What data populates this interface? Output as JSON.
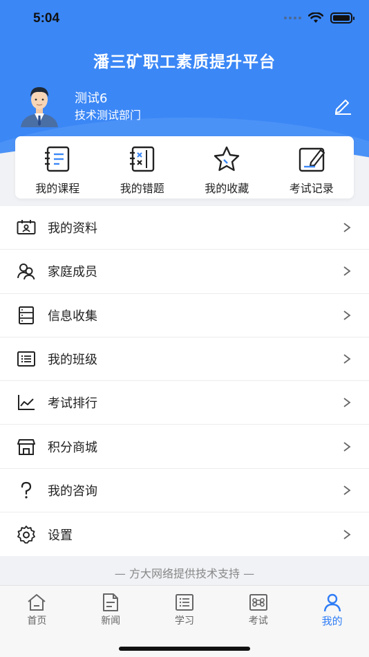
{
  "status_bar": {
    "time": "5:04"
  },
  "header": {
    "title": "潘三矿职工素质提升平台"
  },
  "user": {
    "name": "测试6",
    "department": "技术测试部门"
  },
  "shortcuts": [
    {
      "label": "我的课程",
      "icon": "notebook-icon"
    },
    {
      "label": "我的错题",
      "icon": "wrong-answers-icon"
    },
    {
      "label": "我的收藏",
      "icon": "star-icon"
    },
    {
      "label": "考试记录",
      "icon": "exam-record-icon"
    }
  ],
  "menu": [
    {
      "label": "我的资料",
      "icon": "profile-card-icon"
    },
    {
      "label": "家庭成员",
      "icon": "family-icon"
    },
    {
      "label": "信息收集",
      "icon": "form-icon"
    },
    {
      "label": "我的班级",
      "icon": "class-list-icon"
    },
    {
      "label": "考试排行",
      "icon": "ranking-chart-icon"
    },
    {
      "label": "积分商城",
      "icon": "store-icon"
    },
    {
      "label": "我的咨询",
      "icon": "question-icon"
    },
    {
      "label": "设置",
      "icon": "gear-icon"
    }
  ],
  "footer": {
    "note": "— 方大网络提供技术支持 —"
  },
  "tabbar": [
    {
      "label": "首页",
      "icon": "home-icon"
    },
    {
      "label": "新闻",
      "icon": "news-icon"
    },
    {
      "label": "学习",
      "icon": "study-icon"
    },
    {
      "label": "考试",
      "icon": "exam-icon"
    },
    {
      "label": "我的",
      "icon": "person-icon",
      "active": true
    }
  ],
  "colors": {
    "primary": "#3b87f6",
    "active_tab": "#2f7df6",
    "background": "#f0f2f5"
  }
}
